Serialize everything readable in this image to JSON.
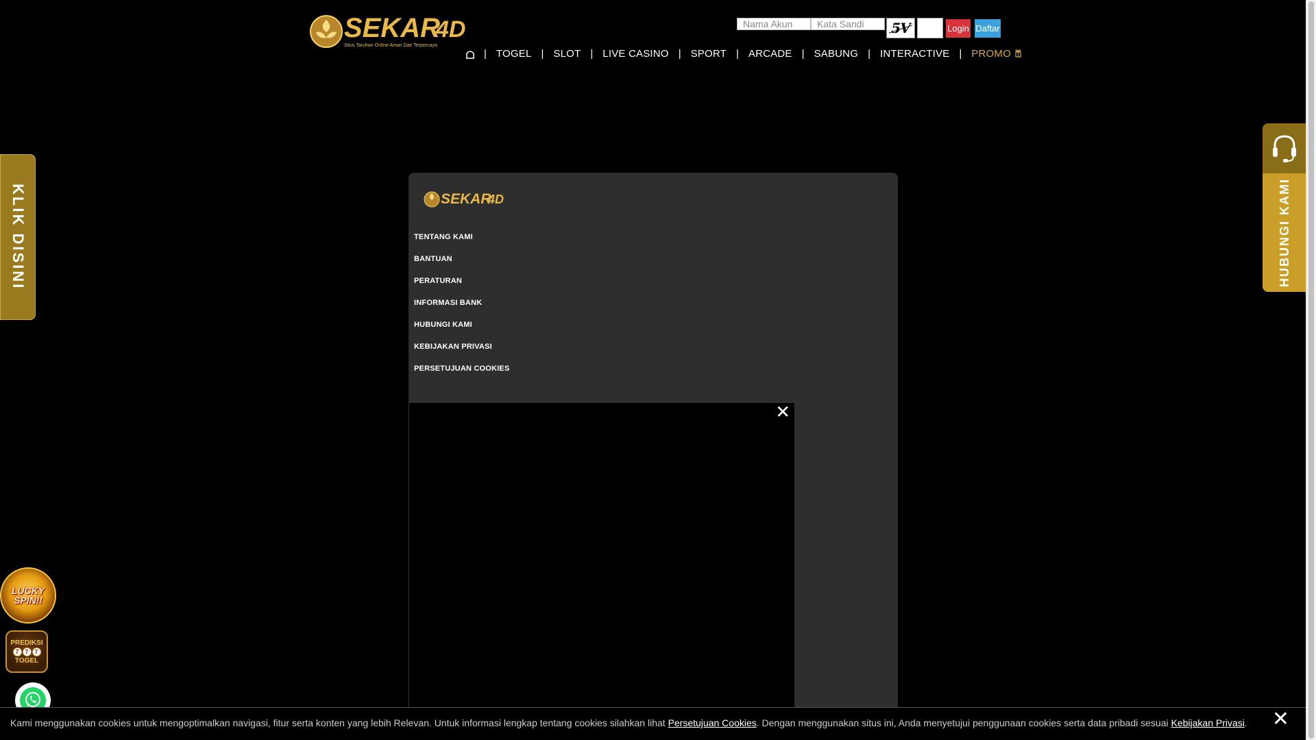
{
  "brand": {
    "name": "SEKAR4D",
    "tagline": "Situs Taruhan Online Aman Dan Terpercaya"
  },
  "login": {
    "username_placeholder": "Nama Akun",
    "password_placeholder": "Kata Sandi",
    "captcha_text": "5V",
    "login_label": "Login",
    "register_label": "Daftar"
  },
  "nav": {
    "home_icon": "home-icon",
    "items": [
      "TOGEL",
      "SLOT",
      "LIVE CASINO",
      "SPORT",
      "ARCADE",
      "SABUNG",
      "INTERACTIVE",
      "PROMO"
    ],
    "promo_icon": "gift-icon"
  },
  "side": {
    "left_tab": "KLIK DISINI",
    "right_tab": "HUBUNGI KAMI",
    "right_icon": "headset-icon"
  },
  "panel": {
    "links": [
      "TENTANG KAMI",
      "BANTUAN",
      "PERATURAN",
      "INFORMASI BANK",
      "HUBUNGI KAMI",
      "KEBIJAKAN PRIVASI",
      "PERSETUJUAN COOKIES"
    ],
    "close_symbol": "✕"
  },
  "floating": {
    "lucky": "LUCKY SPIN!!",
    "prediksi_top": "PREDIKSI",
    "prediksi_balls": [
      "7",
      "7",
      "7"
    ],
    "prediksi_bottom": "TOGEL"
  },
  "cookie": {
    "text_before": "Kami menggunakan cookies untuk mengoptimalkan navigasi, fitur serta konten yang lebih Relevan. Untuk informasi lengkap tentang cookies silahkan lihat ",
    "link1": "Persetujuan Cookies",
    "text_middle": ". Dengan menggunakan situs ini, Anda menyetujui penggunaan cookies serta data pribadi sesuai ",
    "link2": "Kebijakan Privasi",
    "text_after": ".",
    "close_symbol": "✕"
  },
  "colors": {
    "gold": "#d4a94a",
    "login": "#d9343b",
    "daftar": "#3ca0dc",
    "panel": "#2e2e2e"
  }
}
